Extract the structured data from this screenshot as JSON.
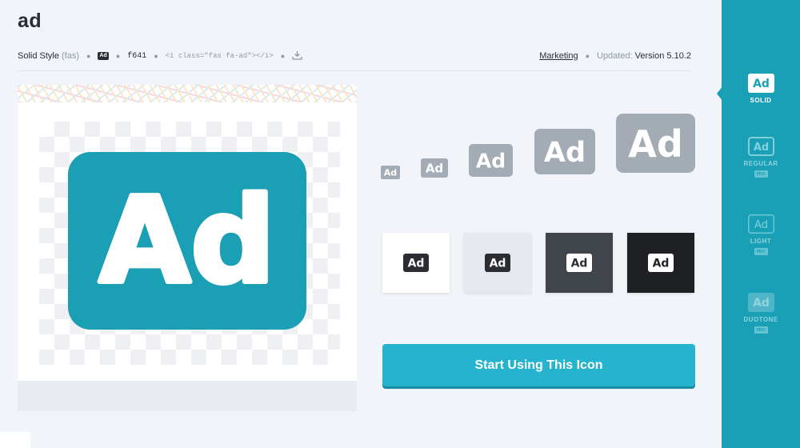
{
  "header": {
    "title": "ad"
  },
  "meta": {
    "style_label": "Solid Style",
    "style_code": "(fas)",
    "badge_text": "Ad",
    "unicode": "f641",
    "html_snippet": "<i class=\"fas fa-ad\"></i>",
    "download_icon": "download-icon",
    "category": "Marketing",
    "updated_label": "Updated:",
    "version": "Version 5.10.2"
  },
  "icon": {
    "text": "Ad",
    "color": "#1a9fb5"
  },
  "sizes": {
    "icon_text": "Ad",
    "color": "#a3acb5"
  },
  "backgrounds": [
    {
      "bg": "#ffffff",
      "badge_bg": "#2b2d33",
      "badge_fg": "#ffffff",
      "text": "Ad"
    },
    {
      "bg": "#e6e9ee",
      "badge_bg": "#2b2d33",
      "badge_fg": "#ffffff",
      "text": "Ad"
    },
    {
      "bg": "#40444b",
      "badge_bg": "#ffffff",
      "badge_fg": "#2b2d33",
      "text": "Ad"
    },
    {
      "bg": "#1e2023",
      "badge_bg": "#ffffff",
      "badge_fg": "#1e2023",
      "text": "Ad"
    }
  ],
  "cta": {
    "label": "Start Using This Icon"
  },
  "sidebar": {
    "accent": "#19a0b6",
    "items": [
      {
        "icon_text": "Ad",
        "label": "SOLID",
        "pro": ""
      },
      {
        "icon_text": "Ad",
        "label": "REGULAR",
        "pro": "PRO"
      },
      {
        "icon_text": "Ad",
        "label": "LIGHT",
        "pro": "PRO"
      },
      {
        "icon_text": "Ad",
        "label": "DUOTONE",
        "pro": "PRO"
      }
    ]
  }
}
